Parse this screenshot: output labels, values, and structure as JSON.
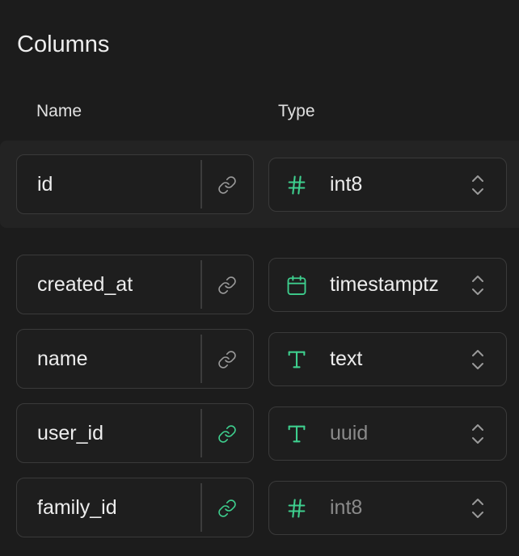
{
  "section": {
    "title": "Columns",
    "headers": {
      "name": "Name",
      "type": "Type"
    }
  },
  "colors": {
    "background": "#1c1c1c",
    "highlight_row": "#232323",
    "accent_green": "#3ecf8e",
    "icon_gray": "#9a9a9a"
  },
  "columns": [
    {
      "name": "id",
      "type": "int8",
      "type_icon": "hash-icon",
      "link_icon": "link-icon",
      "link_active": false,
      "type_muted": false
    },
    {
      "name": "created_at",
      "type": "timestamptz",
      "type_icon": "calendar-icon",
      "link_icon": "link-icon",
      "link_active": false,
      "type_muted": false
    },
    {
      "name": "name",
      "type": "text",
      "type_icon": "text-type-icon",
      "link_icon": "link-icon",
      "link_active": false,
      "type_muted": false
    },
    {
      "name": "user_id",
      "type": "uuid",
      "type_icon": "text-type-icon",
      "link_icon": "link-icon",
      "link_active": true,
      "type_muted": true
    },
    {
      "name": "family_id",
      "type": "int8",
      "type_icon": "hash-icon",
      "link_icon": "link-icon",
      "link_active": true,
      "type_muted": true
    }
  ]
}
